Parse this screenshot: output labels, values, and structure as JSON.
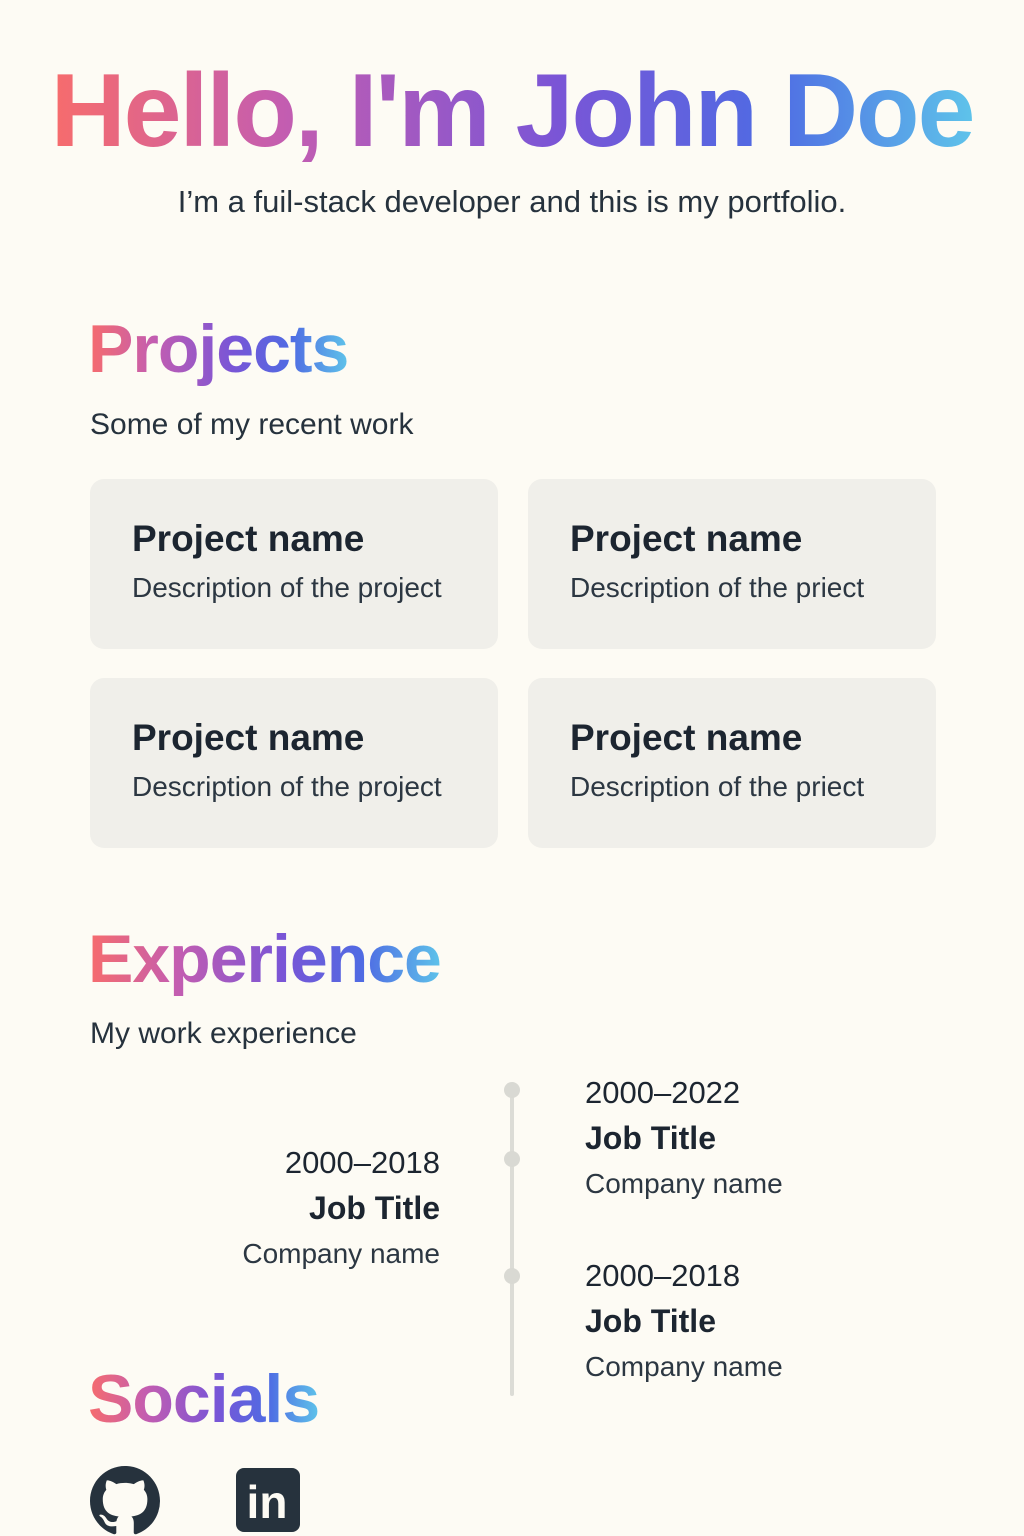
{
  "hero": {
    "title": "Hello, I'm John Doe",
    "subtitle": "I’m a fuil-stack developer and this is my portfolio."
  },
  "projects": {
    "title": "Projects",
    "subtitle": "Some of my recent work",
    "items": [
      {
        "name": "Project name",
        "description": "Description of the project"
      },
      {
        "name": "Project name",
        "description": "Description of the priect"
      },
      {
        "name": "Project name",
        "description": "Description of the project"
      },
      {
        "name": "Project name",
        "description": "Description of the priect"
      }
    ]
  },
  "experience": {
    "title": "Experience",
    "subtitle": "My work experience",
    "left": [
      {
        "years": "2000–2018",
        "title": "Job Title",
        "company": "Company name"
      }
    ],
    "right": [
      {
        "years": "2000–2022",
        "title": "Job Title",
        "company": "Company name"
      },
      {
        "years": "2000–2018",
        "title": "Job Title",
        "company": "Company name"
      }
    ]
  },
  "socials": {
    "title": "Socials",
    "icons": [
      "github-icon",
      "linkedin-icon"
    ],
    "linkedin_text": "in"
  },
  "colors": {
    "background": "#fdfbf4",
    "card": "#f0efea",
    "gradient_start": "#f76c6c",
    "gradient_mid": "#7a55d6",
    "gradient_end": "#5ec3ea",
    "icon": "#26323d"
  }
}
